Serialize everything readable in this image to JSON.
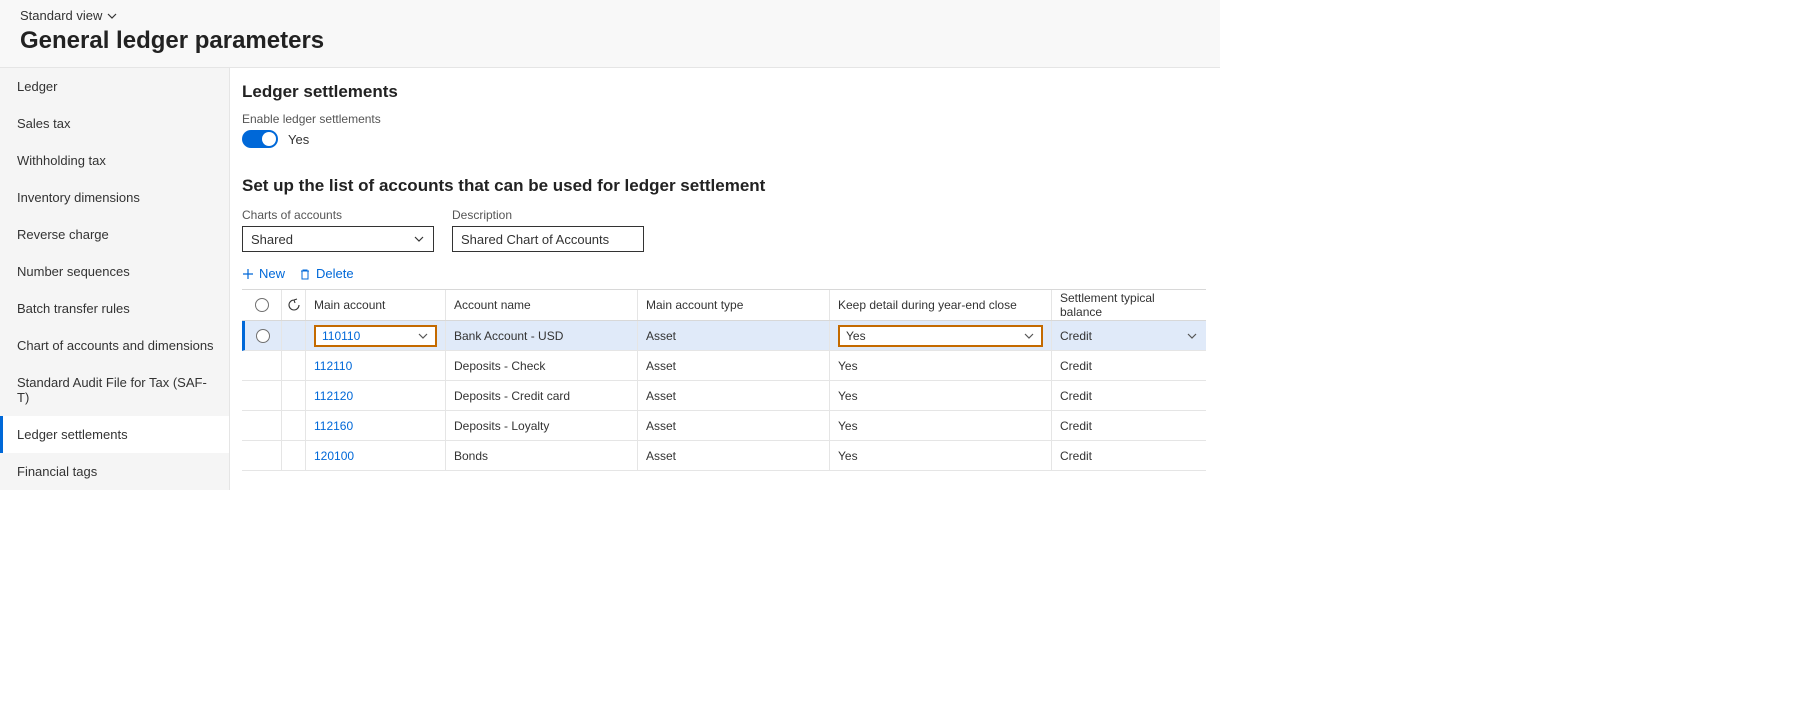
{
  "header": {
    "viewLabel": "Standard view",
    "pageTitle": "General ledger parameters"
  },
  "sidebar": {
    "items": [
      {
        "label": "Ledger"
      },
      {
        "label": "Sales tax"
      },
      {
        "label": "Withholding tax"
      },
      {
        "label": "Inventory dimensions"
      },
      {
        "label": "Reverse charge"
      },
      {
        "label": "Number sequences"
      },
      {
        "label": "Batch transfer rules"
      },
      {
        "label": "Chart of accounts and dimensions"
      },
      {
        "label": "Standard Audit File for Tax (SAF-T)"
      },
      {
        "label": "Ledger settlements"
      },
      {
        "label": "Financial tags"
      }
    ]
  },
  "main": {
    "sectionTitle": "Ledger settlements",
    "enableLabel": "Enable ledger settlements",
    "toggleValue": "Yes",
    "setupTitle": "Set up the list of accounts that can be used for ledger settlement",
    "coaLabel": "Charts of accounts",
    "coaValue": "Shared",
    "descLabel": "Description",
    "descValue": "Shared Chart of Accounts",
    "newLabel": "New",
    "deleteLabel": "Delete",
    "grid": {
      "headers": {
        "main": "Main account",
        "name": "Account name",
        "type": "Main account type",
        "keep": "Keep detail during year-end close",
        "bal": "Settlement typical balance"
      },
      "rows": [
        {
          "main": "110110",
          "name": "Bank Account - USD",
          "type": "Asset",
          "keep": "Yes",
          "bal": "Credit",
          "highlighted": true
        },
        {
          "main": "112110",
          "name": "Deposits - Check",
          "type": "Asset",
          "keep": "Yes",
          "bal": "Credit"
        },
        {
          "main": "112120",
          "name": "Deposits - Credit card",
          "type": "Asset",
          "keep": "Yes",
          "bal": "Credit"
        },
        {
          "main": "112160",
          "name": "Deposits - Loyalty",
          "type": "Asset",
          "keep": "Yes",
          "bal": "Credit"
        },
        {
          "main": "120100",
          "name": "Bonds",
          "type": "Asset",
          "keep": "Yes",
          "bal": "Credit"
        }
      ]
    }
  }
}
